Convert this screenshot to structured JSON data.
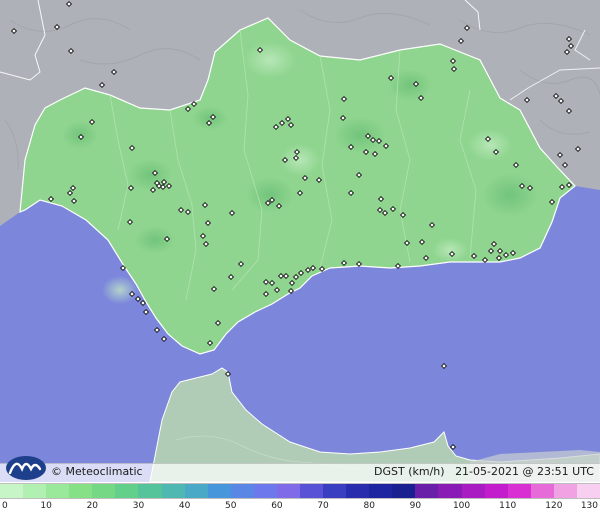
{
  "footer": {
    "brand": "© Meteoclimatic",
    "variable": "DGST (km/h)",
    "timestamp": "21-05-2021 @ 23:51 UTC",
    "logo_icon": "meteoclimatic-wave-logo"
  },
  "scale": {
    "labels": [
      "0",
      "10",
      "20",
      "30",
      "40",
      "50",
      "60",
      "70",
      "80",
      "90",
      "100",
      "110",
      "120",
      "130"
    ],
    "colors": [
      "#c8f5c8",
      "#b2efb2",
      "#9ae89a",
      "#86e086",
      "#74d884",
      "#62cf8a",
      "#56c49a",
      "#4fb8b0",
      "#4aa9c6",
      "#4596da",
      "#5a86e6",
      "#6d78ec",
      "#7f6ae8",
      "#5a52d6",
      "#3a3ec0",
      "#2a2cae",
      "#1f24a0",
      "#1a2090",
      "#6a1fa8",
      "#8a1cb6",
      "#a81cc2",
      "#c21ccc",
      "#d830d2",
      "#e66ad8",
      "#f0a2e2",
      "#f8cff0"
    ]
  },
  "map": {
    "sea_color": "#7c87dc",
    "land_color": "#8fd58f",
    "outside_land_color": "#aeb2b8",
    "africa_land_color": "#b0ccb6"
  }
}
